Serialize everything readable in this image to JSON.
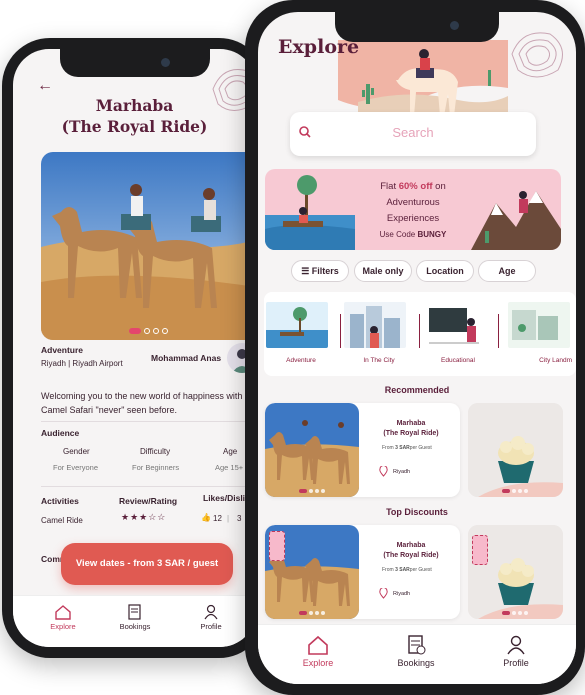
{
  "colors": {
    "brand": "#5a1f3a",
    "accent": "#e05a52",
    "pink": "#f7c9d3",
    "active_tab": "#c23a5c"
  },
  "details": {
    "back_icon": "back-arrow-icon",
    "title": "Marhaba\n(The Royal Ride)",
    "title_line1": "Marhaba",
    "title_line2": "(The Royal Ride)",
    "adventure_label": "Adventure",
    "location": "Riyadh  |  Riyadh Airport",
    "host": "Mohammad Anas",
    "welcome": "Welcoming you to the new world of happiness with a Camel Safari \"never\" seen before.",
    "audience_label": "Audience",
    "gender_label": "Gender",
    "gender_value": "For Everyone",
    "difficulty_label": "Difficulty",
    "difficulty_value": "For Beginners",
    "age_label": "Age",
    "age_value": "Age 15+",
    "activities_label": "Activities",
    "activities_value": "Camel Ride",
    "review_label": "Review/Rating",
    "likes_label": "Likes/Dislikes",
    "likes_value": "12",
    "dislikes_value": "3",
    "rating": 3.5,
    "comments_label": "Comm",
    "cta": "View dates - from 3 SAR / guest",
    "tabs": [
      "Explore",
      "Bookings",
      "Profile"
    ]
  },
  "explore": {
    "title": "Explore",
    "search_placeholder": "Search",
    "promo": {
      "line1_pre": "Flat ",
      "line1_bold": "60% off",
      "line1_post": " on",
      "line2": "Adventurous",
      "line3": "Experiences",
      "code_pre": "Use Code ",
      "code": "BUNGY"
    },
    "chips": [
      "Filters",
      "Male only",
      "Location",
      "Age"
    ],
    "categories": [
      "Adventure",
      "In The City",
      "Educational",
      "City Landm"
    ],
    "recommended_title": "Recommended",
    "top_discounts_title": "Top Discounts",
    "card": {
      "title_line1": "Marhaba",
      "title_line2": "(The Royal Ride)",
      "price_pre": "From ",
      "price": "3 SAR",
      "price_post": "per Guest",
      "location": "Riyadh"
    },
    "tabs": [
      "Explore",
      "Bookings",
      "Profile"
    ]
  }
}
